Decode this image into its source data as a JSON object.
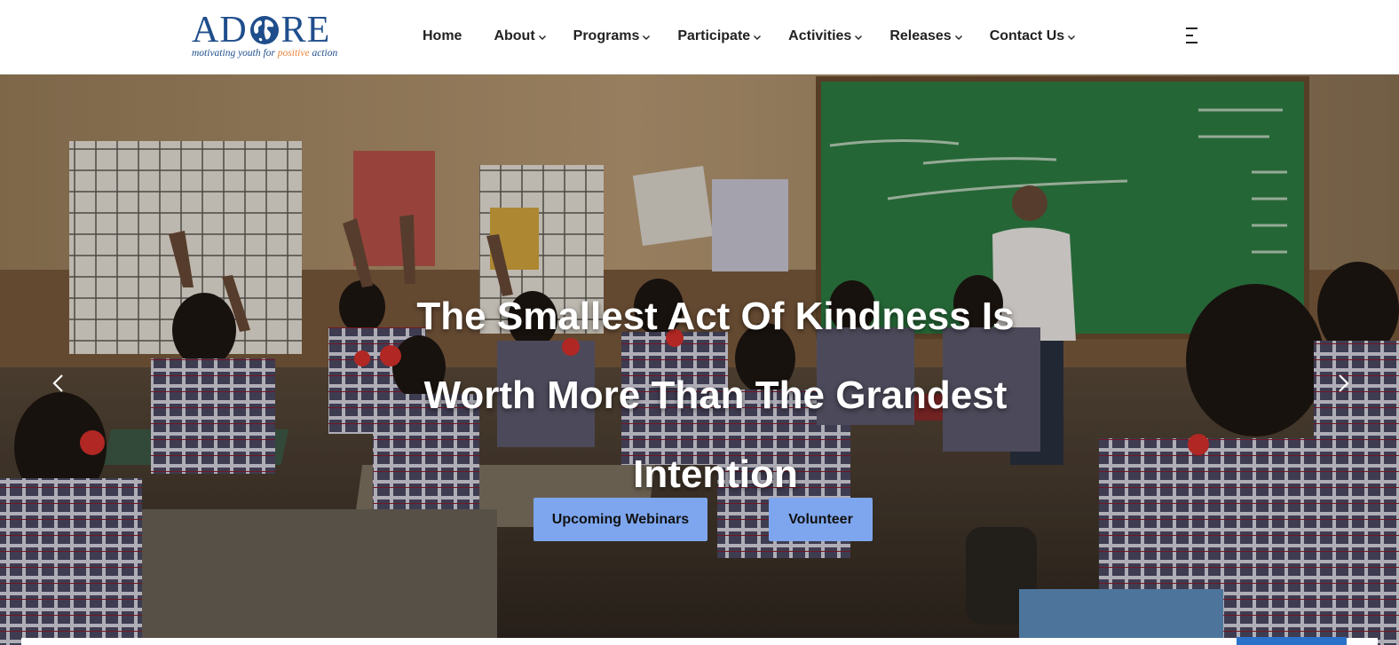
{
  "brand": {
    "name_left": "AD",
    "name_right": "RE",
    "tagline_pre": "motivating youth for",
    "tagline_accent": "positive",
    "tagline_post": "action",
    "primary_color": "#1f4e8c",
    "accent_color": "#e8853d",
    "globe_icon": "globe-icon"
  },
  "nav": {
    "items": [
      {
        "label": "Home",
        "has_dropdown": false
      },
      {
        "label": "About",
        "has_dropdown": true
      },
      {
        "label": "Programs",
        "has_dropdown": true
      },
      {
        "label": "Participate",
        "has_dropdown": true
      },
      {
        "label": "Activities",
        "has_dropdown": true
      },
      {
        "label": "Releases",
        "has_dropdown": true
      },
      {
        "label": "Contact Us",
        "has_dropdown": true
      }
    ],
    "menu_icon": "hamburger-menu-icon"
  },
  "hero": {
    "title_line1": "The Smallest Act Of Kindness Is",
    "title_line2": "Worth More Than The Grandest",
    "title_line3": "Intention",
    "buttons": {
      "webinars": "Upcoming Webinars",
      "volunteer": "Volunteer"
    },
    "button_color": "#7ea6ee",
    "prev_icon": "chevron-left-icon",
    "next_icon": "chevron-right-icon",
    "image": "classroom-photo"
  },
  "colors": {
    "nav_text": "#222222",
    "hero_text": "#ffffff",
    "indicator": "#2a72c9"
  }
}
